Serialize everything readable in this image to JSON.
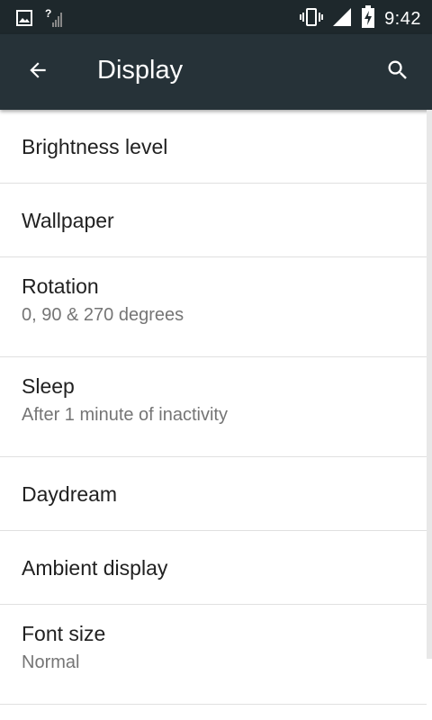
{
  "status_bar": {
    "time": "9:42",
    "icons": [
      "image-notification-icon",
      "signal-unknown-icon",
      "vibrate-icon",
      "cell-signal-icon",
      "battery-charging-icon"
    ]
  },
  "app_bar": {
    "title": "Display",
    "back_icon": "arrow-back-icon",
    "search_icon": "search-icon",
    "background": "#263238"
  },
  "settings": [
    {
      "title": "Brightness level",
      "summary": ""
    },
    {
      "title": "Wallpaper",
      "summary": ""
    },
    {
      "title": "Rotation",
      "summary": "0, 90 & 270 degrees"
    },
    {
      "title": "Sleep",
      "summary": "After 1 minute of inactivity"
    },
    {
      "title": "Daydream",
      "summary": ""
    },
    {
      "title": "Ambient display",
      "summary": ""
    },
    {
      "title": "Font size",
      "summary": "Normal"
    }
  ],
  "colors": {
    "status_bar": "#1e282c",
    "app_bar": "#263238",
    "title_text": "#212121",
    "summary_text": "#757575",
    "divider": "#e0e0e0"
  }
}
